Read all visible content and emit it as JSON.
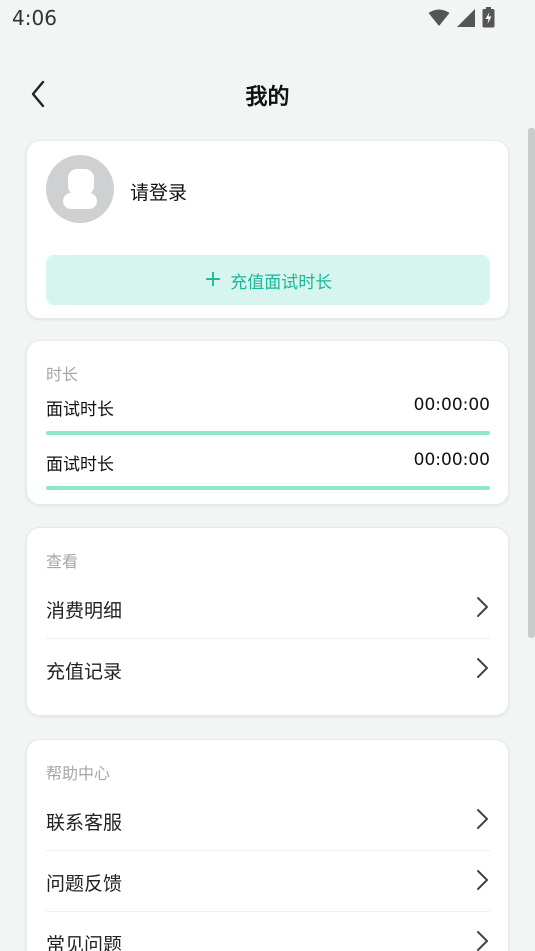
{
  "status_bar": {
    "time": "4:06"
  },
  "header": {
    "title": "我的"
  },
  "user_card": {
    "login_text": "请登录",
    "recharge_button": {
      "icon": "+",
      "label": "充值面试时长"
    }
  },
  "duration_card": {
    "section_label": "时长",
    "rows": [
      {
        "name": "面试时长",
        "value": "00:00:00",
        "progress": 1.0
      },
      {
        "name": "面试时长",
        "value": "00:00:00",
        "progress": 1.0
      }
    ]
  },
  "view_card": {
    "section_label": "查看",
    "items": [
      {
        "label": "消费明细"
      },
      {
        "label": "充值记录"
      }
    ]
  },
  "help_card": {
    "section_label": "帮助中心",
    "items": [
      {
        "label": "联系客服"
      },
      {
        "label": "问题反馈"
      },
      {
        "label": "常见问题"
      }
    ]
  },
  "colors": {
    "accent": "#18b89a",
    "accent_light": "#d6f5ef",
    "progress": "#8ee6cf",
    "background": "#f1f6f4"
  }
}
